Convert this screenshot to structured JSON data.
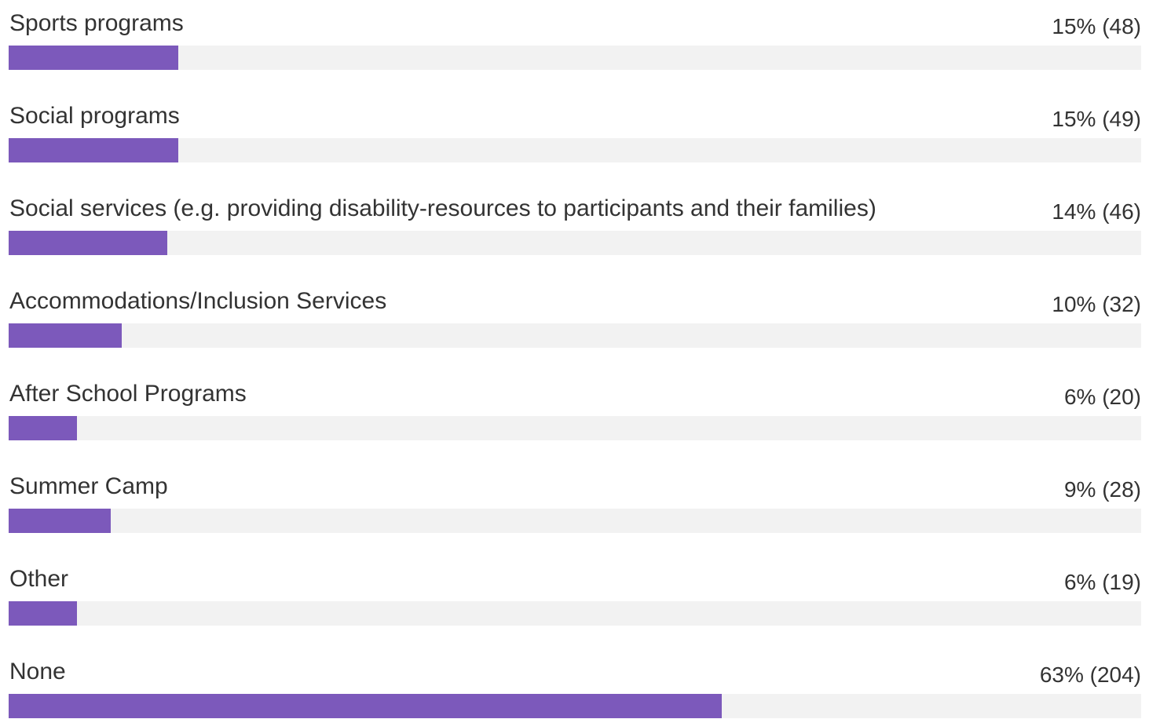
{
  "chart_data": {
    "type": "bar",
    "orientation": "horizontal",
    "categories": [
      "Sports programs",
      "Social programs",
      "Social services (e.g. providing disability-resources to participants and their families)",
      "Accommodations/Inclusion Services",
      "After School Programs",
      "Summer Camp",
      "Other",
      "None"
    ],
    "values": [
      15,
      15,
      14,
      10,
      6,
      9,
      6,
      63
    ],
    "counts": [
      48,
      49,
      46,
      32,
      20,
      28,
      19,
      204
    ],
    "value_labels": [
      "15% (48)",
      "15% (49)",
      "14% (46)",
      "10% (32)",
      "6% (20)",
      "9% (28)",
      "6% (19)",
      "63% (204)"
    ],
    "xlim": [
      0,
      100
    ],
    "bar_color": "#7c59bb",
    "track_color": "#f2f2f2",
    "grid": false
  }
}
